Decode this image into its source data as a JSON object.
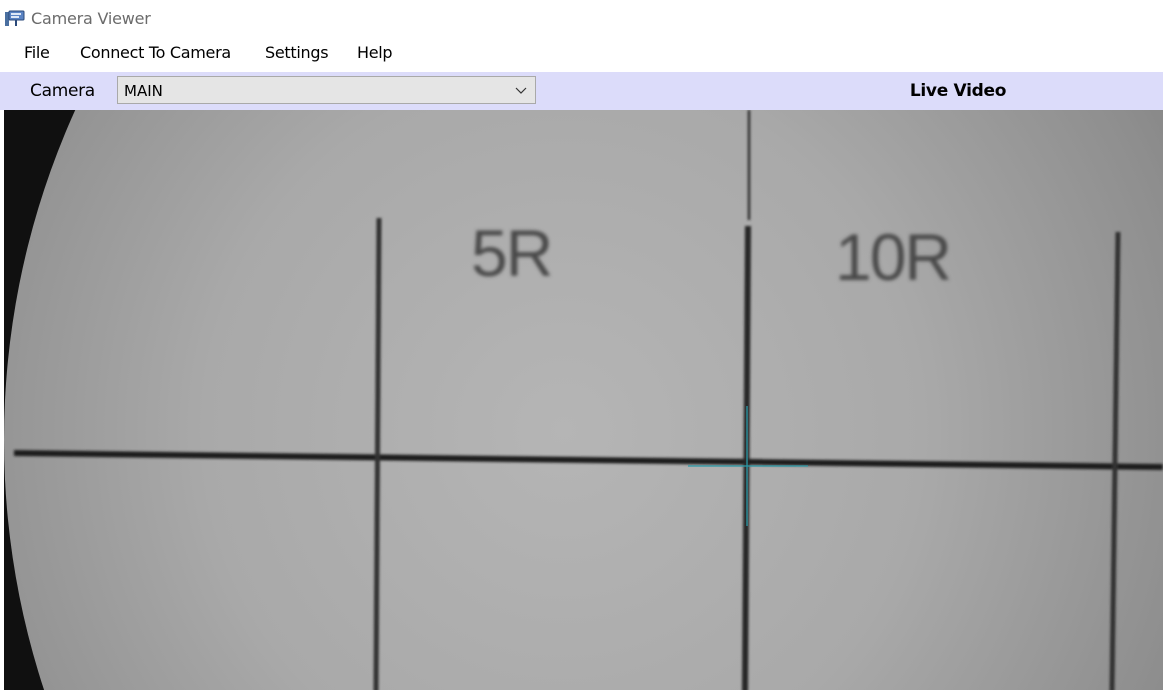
{
  "window": {
    "title": "Camera Viewer"
  },
  "menu": {
    "items": [
      "File",
      "Connect To Camera",
      "Settings",
      "Help"
    ]
  },
  "toolbar": {
    "camera_label": "Camera",
    "camera_selected": "MAIN",
    "view_mode_label": "Live Video"
  },
  "video": {
    "reticle_labels": [
      "5R",
      "10R"
    ],
    "crosshair_color": "#2a9aa8"
  }
}
